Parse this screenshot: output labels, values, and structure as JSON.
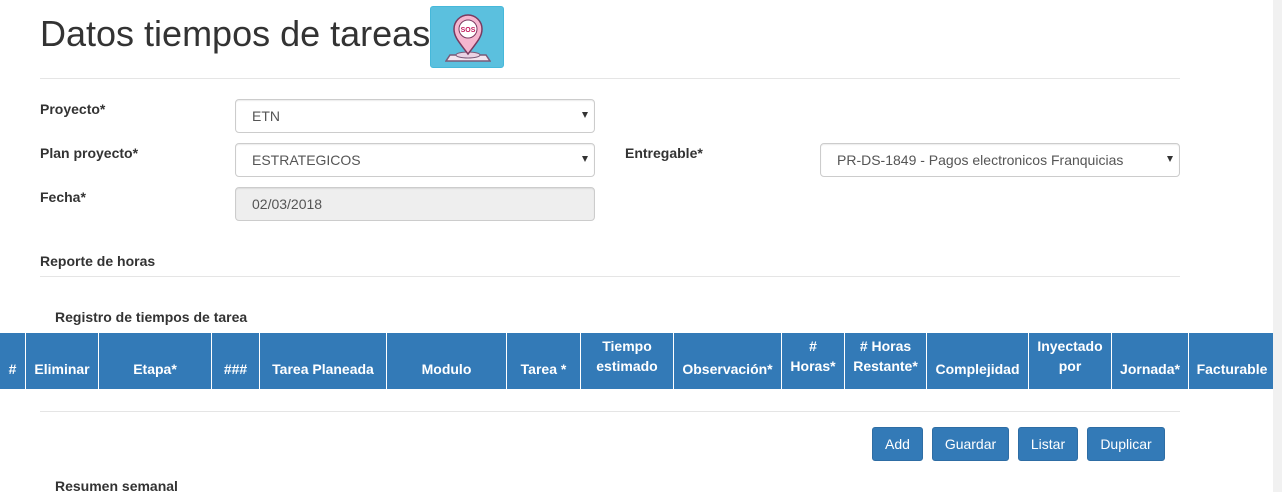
{
  "page": {
    "title": "Datos tiempos de tareas"
  },
  "form": {
    "proyecto": {
      "label": "Proyecto*",
      "value": "ETN"
    },
    "plan_proyecto": {
      "label": "Plan proyecto*",
      "value": "ESTRATEGICOS"
    },
    "entregable": {
      "label": "Entregable*",
      "value": "PR-DS-1849 - Pagos electronicos Franquicias"
    },
    "fecha": {
      "label": "Fecha*",
      "value": "02/03/2018"
    }
  },
  "sections": {
    "reporte": "Reporte de horas",
    "registro": "Registro de tiempos de tarea",
    "resumen": "Resumen semanal"
  },
  "table": {
    "columns": [
      {
        "l1": "",
        "l2": "#"
      },
      {
        "l1": "",
        "l2": "Eliminar"
      },
      {
        "l1": "",
        "l2": "Etapa*"
      },
      {
        "l1": "",
        "l2": "###"
      },
      {
        "l1": "",
        "l2": "Tarea Planeada"
      },
      {
        "l1": "",
        "l2": "Modulo"
      },
      {
        "l1": "",
        "l2": "Tarea *"
      },
      {
        "l1": "Tiempo",
        "l2": "estimado"
      },
      {
        "l1": "",
        "l2": "Observación*"
      },
      {
        "l1": "#",
        "l2": "Horas*"
      },
      {
        "l1": "# Horas",
        "l2": "Restante*"
      },
      {
        "l1": "",
        "l2": "Complejidad"
      },
      {
        "l1": "Inyectado",
        "l2": "por"
      },
      {
        "l1": "",
        "l2": "Jornada*"
      },
      {
        "l1": "",
        "l2": "Facturable"
      }
    ]
  },
  "buttons": {
    "add": "Add",
    "guardar": "Guardar",
    "listar": "Listar",
    "duplicar": "Duplicar"
  },
  "sos_icon": {
    "text": "SOS"
  },
  "colors": {
    "primary": "#337ab7",
    "info": "#5bc0de"
  }
}
